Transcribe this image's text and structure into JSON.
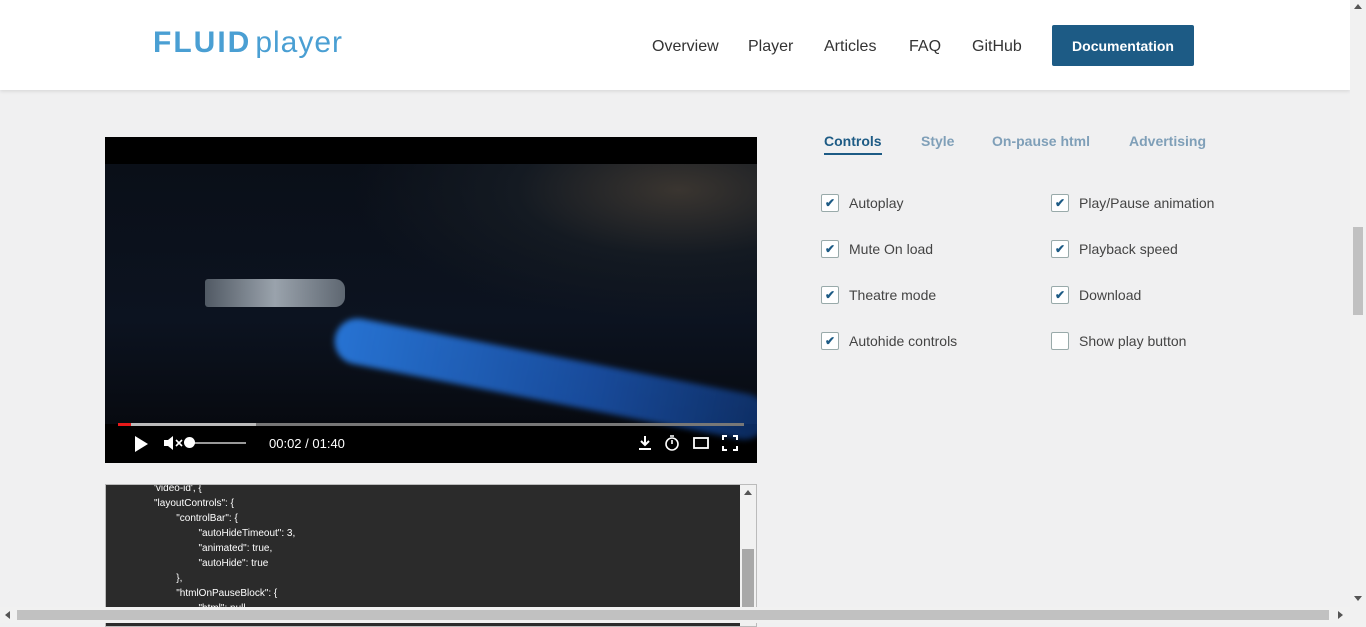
{
  "header": {
    "logo_bold": "FLUID",
    "logo_light": "player",
    "nav": [
      "Overview",
      "Player",
      "Articles",
      "FAQ",
      "GitHub"
    ],
    "cta": "Documentation"
  },
  "player": {
    "time": "00:02 / 01:40",
    "progress_fraction": 0.02,
    "buffered_fraction": 0.22,
    "volume_fraction": 0.0,
    "icons": [
      "play-icon",
      "mute-icon",
      "download-icon",
      "speed-icon",
      "theatre-icon",
      "fullscreen-icon"
    ]
  },
  "tabs": [
    {
      "label": "Controls",
      "active": true
    },
    {
      "label": "Style",
      "active": false
    },
    {
      "label": "On-pause html",
      "active": false
    },
    {
      "label": "Advertising",
      "active": false
    }
  ],
  "options": [
    {
      "label": "Autoplay",
      "checked": true
    },
    {
      "label": "Play/Pause animation",
      "checked": true
    },
    {
      "label": "Mute On load",
      "checked": true
    },
    {
      "label": "Playback speed",
      "checked": true
    },
    {
      "label": "Theatre mode",
      "checked": true
    },
    {
      "label": "Download",
      "checked": true
    },
    {
      "label": "Autohide controls",
      "checked": true
    },
    {
      "label": "Show play button",
      "checked": false
    }
  ],
  "code": {
    "text": "'video-id', {\n\"layoutControls\": {\n        \"controlBar\": {\n                \"autoHideTimeout\": 3,\n                \"animated\": true,\n                \"autoHide\": true\n        },\n        \"htmlOnPauseBlock\": {\n                \"html\": null,"
  },
  "colors": {
    "accent": "#1d5b85",
    "tab_inactive": "#7f9fb8",
    "logo": "#4a9fd3",
    "progress": "#e81919"
  }
}
